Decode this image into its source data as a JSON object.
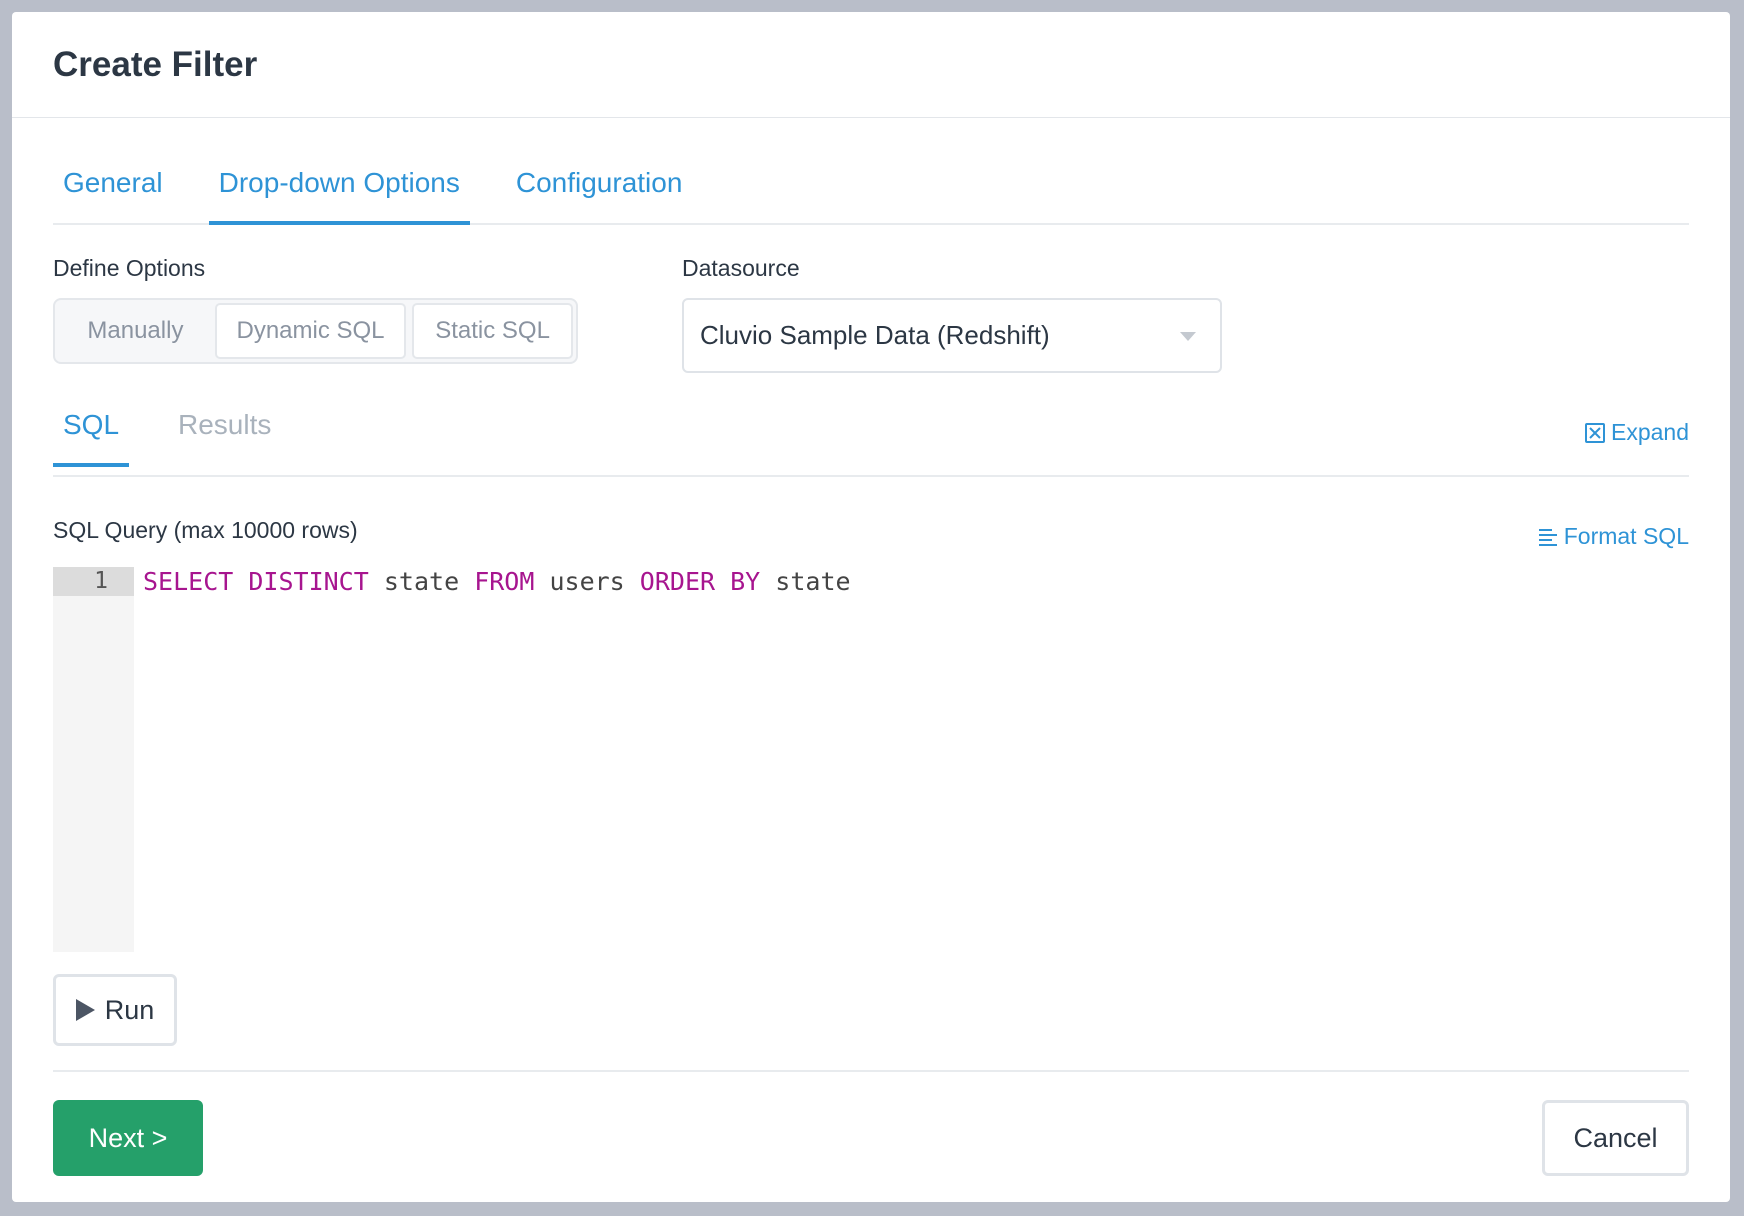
{
  "modal": {
    "title": "Create Filter"
  },
  "tabs": [
    "General",
    "Drop-down Options",
    "Configuration"
  ],
  "define_options": {
    "label": "Define Options",
    "choices": [
      "Manually",
      "Dynamic SQL",
      "Static SQL"
    ]
  },
  "datasource": {
    "label": "Datasource",
    "selected": "Cluvio Sample Data (Redshift)"
  },
  "sub_tabs": [
    "SQL",
    "Results"
  ],
  "expand_label": "Expand",
  "query": {
    "label": "SQL Query (max 10000 rows)",
    "format_label": "Format SQL",
    "line_number": "1",
    "tokens": [
      "SELECT",
      "DISTINCT",
      "state",
      "FROM",
      "users",
      "ORDER",
      "BY",
      "state"
    ]
  },
  "buttons": {
    "run": "Run",
    "next": "Next >",
    "cancel": "Cancel"
  },
  "colors": {
    "accent": "#2e93d6",
    "primary": "#25a06a",
    "keyword": "#a7158f"
  }
}
